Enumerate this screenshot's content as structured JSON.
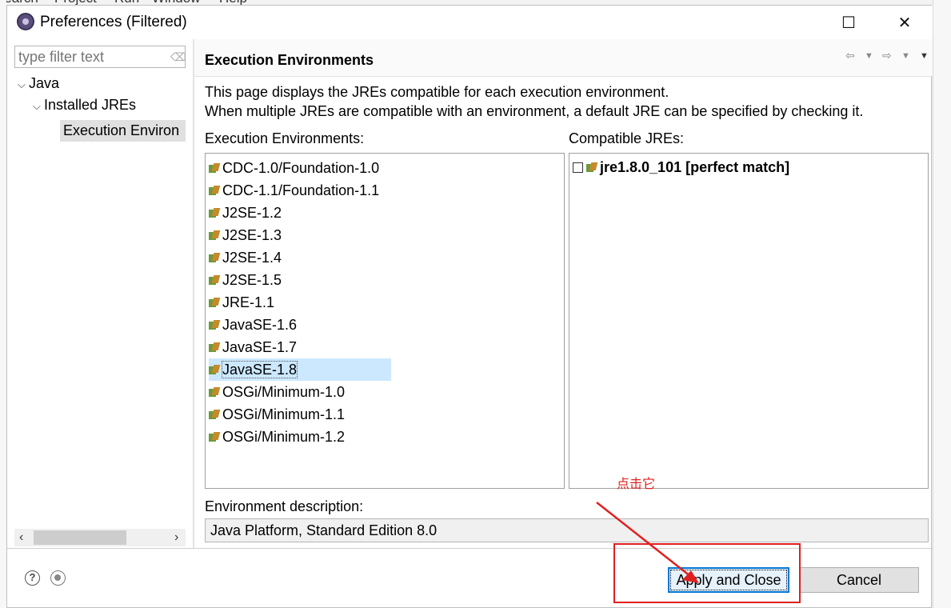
{
  "background_menu": [
    "Search",
    "Project",
    "Run",
    "Window",
    "Help"
  ],
  "window": {
    "title": "Preferences (Filtered)",
    "controls": {
      "minimize": "—",
      "maximize": "☐",
      "close": "✕"
    }
  },
  "sidebar": {
    "filter_placeholder": "type filter text",
    "tree": [
      {
        "label": "Java",
        "expanded": true
      },
      {
        "label": "Installed JREs",
        "expanded": true
      },
      {
        "label": "Execution Environ",
        "selected": true
      }
    ]
  },
  "page": {
    "title": "Execution Environments",
    "description_line1": "This page displays the JREs compatible for each execution environment.",
    "description_line2": "When multiple JREs are compatible with an environment, a default JRE can be specified by checking it.",
    "ee_label": "Execution Environments:",
    "jre_label": "Compatible JREs:",
    "environments": [
      "CDC-1.0/Foundation-1.0",
      "CDC-1.1/Foundation-1.1",
      "J2SE-1.2",
      "J2SE-1.3",
      "J2SE-1.4",
      "J2SE-1.5",
      "JRE-1.1",
      "JavaSE-1.6",
      "JavaSE-1.7",
      "JavaSE-1.8",
      "OSGi/Minimum-1.0",
      "OSGi/Minimum-1.1",
      "OSGi/Minimum-1.2"
    ],
    "selected_environment": "JavaSE-1.8",
    "compatible_jres": [
      {
        "label": "jre1.8.0_101 [perfect match]",
        "checked": false
      }
    ],
    "env_description_label": "Environment description:",
    "env_description_value": "Java Platform, Standard Edition 8.0"
  },
  "footer": {
    "apply_close_label": "Apply and Close",
    "cancel_label": "Cancel"
  },
  "annotation": {
    "text": "点击它",
    "color": "#e02020"
  },
  "colors": {
    "selection": "#cce8ff",
    "focus_border": "#0078d7"
  }
}
